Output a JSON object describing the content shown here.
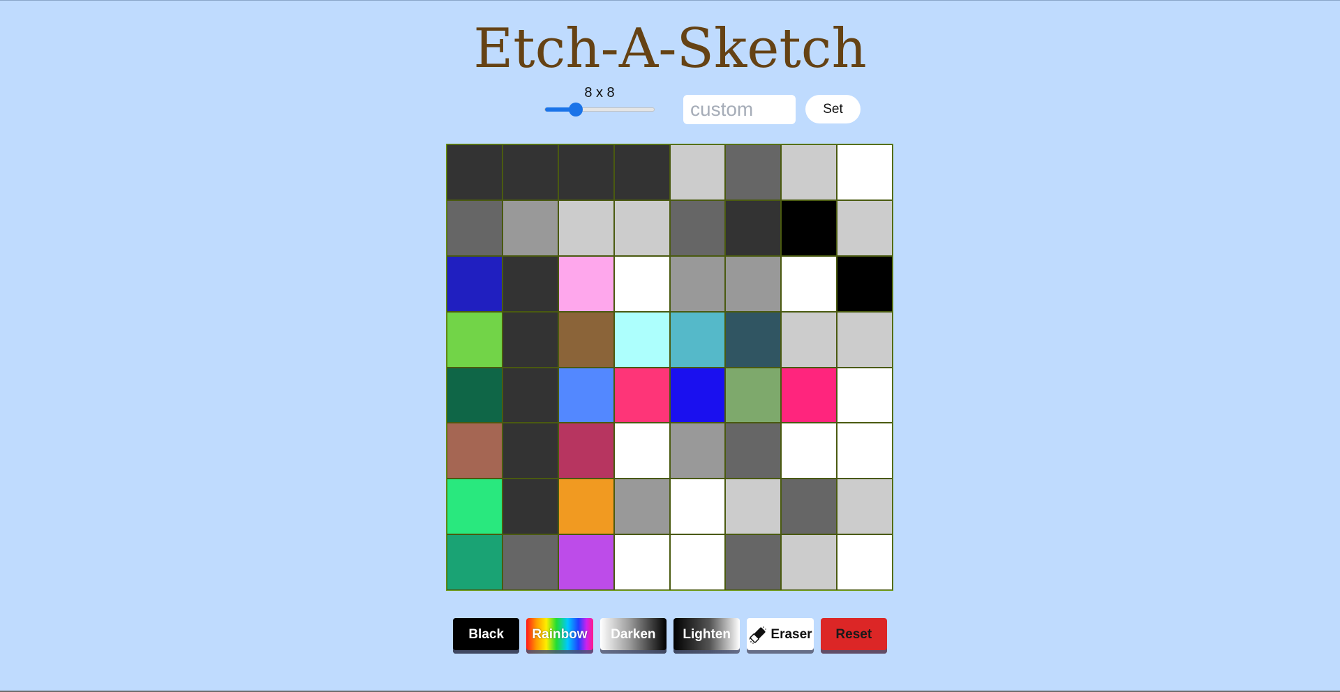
{
  "app": {
    "title": "Etch-A-Sketch"
  },
  "controls": {
    "size_label": "8 x 8",
    "slider": {
      "min": 1,
      "max": 64,
      "value": 8,
      "fill_fraction": 0.28
    },
    "custom_input": {
      "value": "",
      "placeholder": "custom"
    },
    "set_label": "Set"
  },
  "grid": {
    "rows": 8,
    "cols": 8,
    "cells": [
      [
        "#333333",
        "#333333",
        "#333333",
        "#333333",
        "#cccccc",
        "#666666",
        "#cccccc",
        "#ffffff"
      ],
      [
        "#666666",
        "#999999",
        "#cccccc",
        "#cccccc",
        "#666666",
        "#333333",
        "#000000",
        "#cccccc"
      ],
      [
        "#201fc0",
        "#333333",
        "#fea7ec",
        "#ffffff",
        "#999999",
        "#999999",
        "#ffffff",
        "#000000"
      ],
      [
        "#72d448",
        "#333333",
        "#8b6439",
        "#adfffd",
        "#55b9c9",
        "#305562",
        "#cccccc",
        "#cccccc"
      ],
      [
        "#0f6647",
        "#333333",
        "#5388ff",
        "#fe3578",
        "#1a10ef",
        "#7ea96c",
        "#ff257d",
        "#ffffff"
      ],
      [
        "#a56653",
        "#333333",
        "#b73560",
        "#ffffff",
        "#999999",
        "#666666",
        "#ffffff",
        "#ffffff"
      ],
      [
        "#29e87e",
        "#333333",
        "#f19a21",
        "#999999",
        "#ffffff",
        "#cccccc",
        "#666666",
        "#cccccc"
      ],
      [
        "#1aa374",
        "#666666",
        "#bd4ce9",
        "#ffffff",
        "#ffffff",
        "#666666",
        "#cccccc",
        "#ffffff"
      ]
    ]
  },
  "modes": {
    "black_label": "Black",
    "rainbow_label": "Rainbow",
    "darken_label": "Darken",
    "lighten_label": "Lighten",
    "eraser_label": "Eraser",
    "eraser_icon": "eraser-icon",
    "reset_label": "Reset"
  },
  "colors": {
    "background": "#bfdbfe",
    "title": "#654214",
    "accent": "#1a73e8",
    "reset": "#dc2626"
  }
}
